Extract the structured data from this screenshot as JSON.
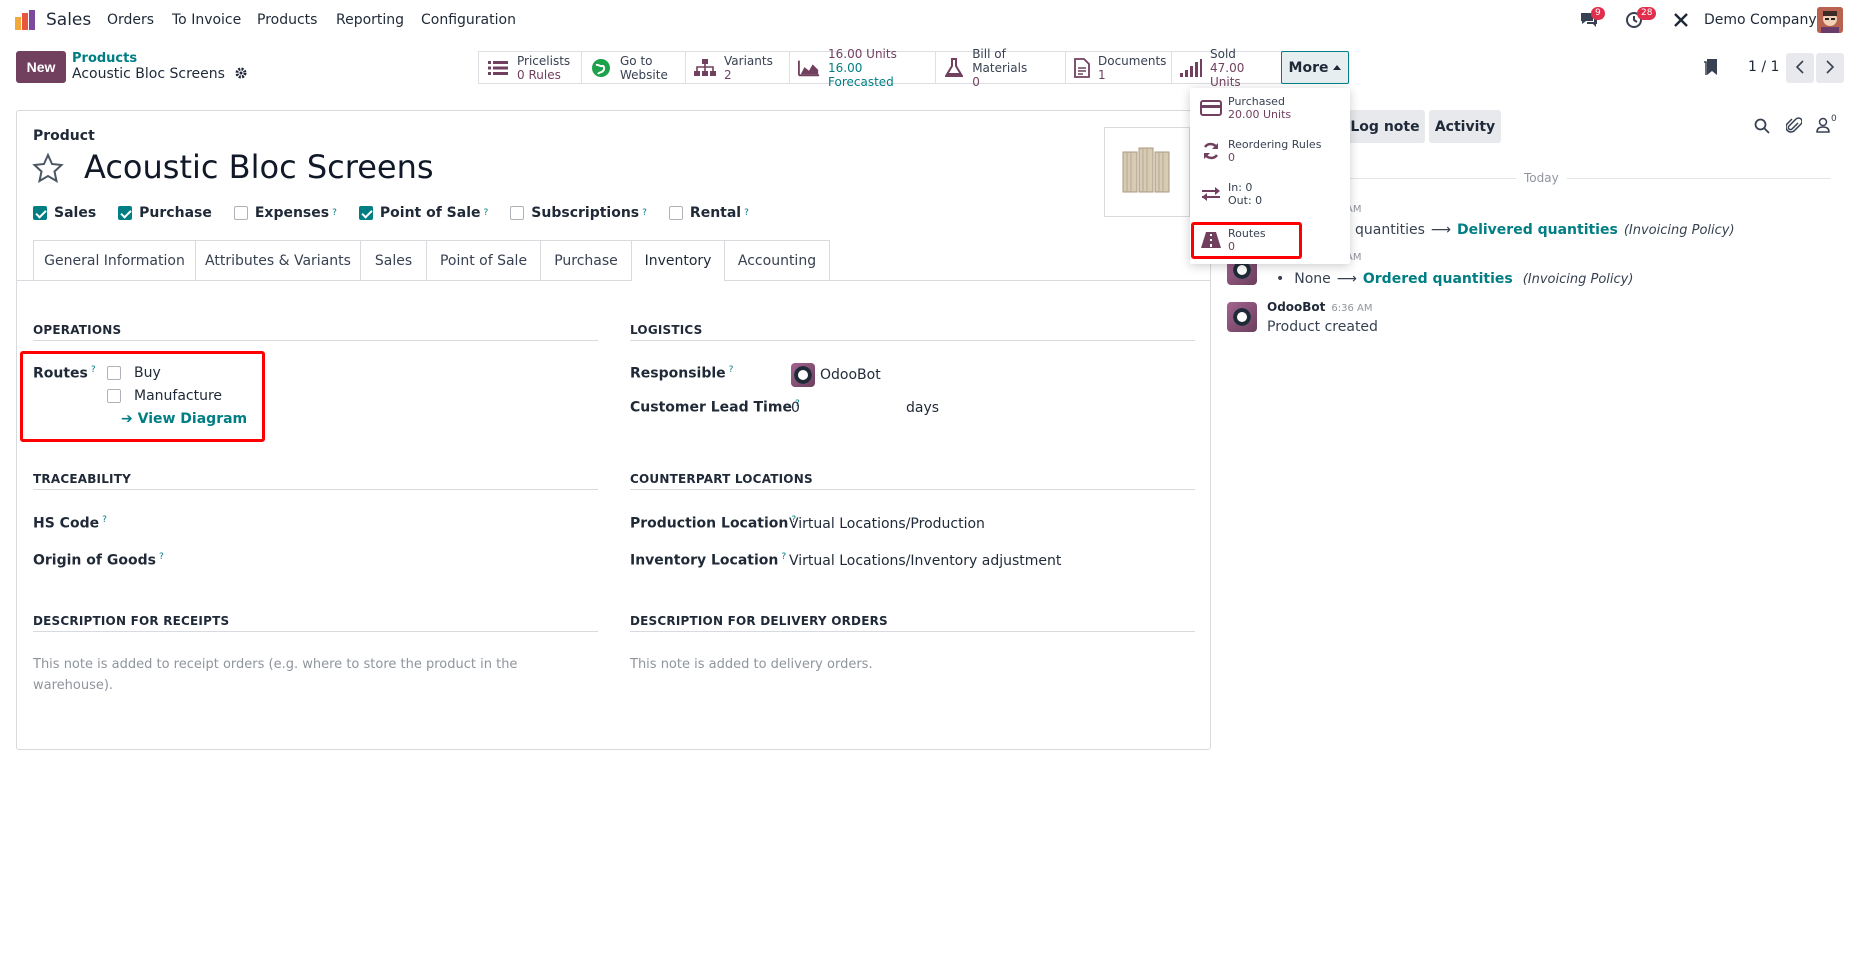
{
  "navbar": {
    "app_name": "Sales",
    "menu": [
      "Orders",
      "To Invoice",
      "Products",
      "Reporting",
      "Configuration"
    ],
    "messages_badge": "9",
    "activities_badge": "28",
    "company": "Demo Company"
  },
  "control": {
    "new_label": "New",
    "breadcrumb_parent": "Products",
    "breadcrumb_current": "Acoustic Bloc Screens",
    "pager": "1 / 1",
    "more_label": "More"
  },
  "smart_buttons": [
    {
      "line1": "Pricelists",
      "line2": "0 Rules",
      "icon": "list-icon"
    },
    {
      "line1": "Go to",
      "line2": "Website",
      "icon": "globe-icon"
    },
    {
      "line1": "Variants",
      "line2": "2",
      "icon": "sitemap-icon"
    },
    {
      "line1": "16.00 Units",
      "line2": "16.00 Forecasted",
      "icon": "area-chart-icon"
    },
    {
      "line1": "Bill of Materials",
      "line2": "0",
      "icon": "flask-icon"
    },
    {
      "line1": "Documents",
      "line2": "1",
      "icon": "file-icon"
    },
    {
      "line1": "Sold",
      "line2": "47.00 Units",
      "icon": "signal-icon"
    }
  ],
  "more_menu": [
    {
      "line1": "Purchased",
      "line2": "20.00 Units",
      "icon": "credit-card-icon"
    },
    {
      "line1": "Reordering Rules",
      "line2": "0",
      "icon": "refresh-icon"
    },
    {
      "line1": "In: 0",
      "line2": "Out: 0",
      "icon": "exchange-icon"
    },
    {
      "line1": "Routes",
      "line2": "0",
      "icon": "road-icon"
    }
  ],
  "form": {
    "product_label": "Product",
    "product_name": "Acoustic Bloc Screens",
    "flags": [
      {
        "label": "Sales",
        "checked": true,
        "help": false
      },
      {
        "label": "Purchase",
        "checked": true,
        "help": false
      },
      {
        "label": "Expenses",
        "checked": false,
        "help": true
      },
      {
        "label": "Point of Sale",
        "checked": true,
        "help": true
      },
      {
        "label": "Subscriptions",
        "checked": false,
        "help": true
      },
      {
        "label": "Rental",
        "checked": false,
        "help": true
      }
    ],
    "tabs": [
      "General Information",
      "Attributes & Variants",
      "Sales",
      "Point of Sale",
      "Purchase",
      "Inventory",
      "Accounting"
    ],
    "active_tab": "Inventory",
    "operations": {
      "title": "OPERATIONS",
      "routes_label": "Routes",
      "routes": [
        "Buy",
        "Manufacture"
      ],
      "view_diagram": "View Diagram"
    },
    "logistics": {
      "title": "LOGISTICS",
      "responsible_label": "Responsible",
      "responsible_value": "OdooBot",
      "lead_time_label": "Customer Lead Time",
      "lead_time_value": "0",
      "lead_time_unit": "days"
    },
    "traceability": {
      "title": "TRACEABILITY",
      "hs_code_label": "HS Code",
      "origin_label": "Origin of Goods"
    },
    "counterpart": {
      "title": "COUNTERPART LOCATIONS",
      "production_label": "Production Location",
      "production_value": "Virtual Locations/Production",
      "inventory_label": "Inventory Location",
      "inventory_value": "Virtual Locations/Inventory adjustment"
    },
    "receipts": {
      "title": "DESCRIPTION FOR RECEIPTS",
      "placeholder": "This note is added to receipt orders (e.g. where to store the product in the warehouse)."
    },
    "delivery": {
      "title": "DESCRIPTION FOR DELIVERY ORDERS",
      "placeholder": "This note is added to delivery orders."
    }
  },
  "chatter": {
    "log_note": "Log note",
    "activity": "Activity",
    "followers_count": "0",
    "today": "Today",
    "msg1_time": "AM",
    "msg1_old": "quantities",
    "msg1_new": "Delivered quantities",
    "msg1_field": "(Invoicing Policy)",
    "msg2_time": "AM",
    "msg2_old": "None",
    "msg2_new": "Ordered quantities",
    "msg2_field": "(Invoicing Policy)",
    "msg3_author": "OdooBot",
    "msg3_time": "6:36 AM",
    "msg3_body": "Product created"
  },
  "colors": {
    "brand": "#71405f",
    "accent": "#017e84",
    "highlight": "#ff0000"
  }
}
